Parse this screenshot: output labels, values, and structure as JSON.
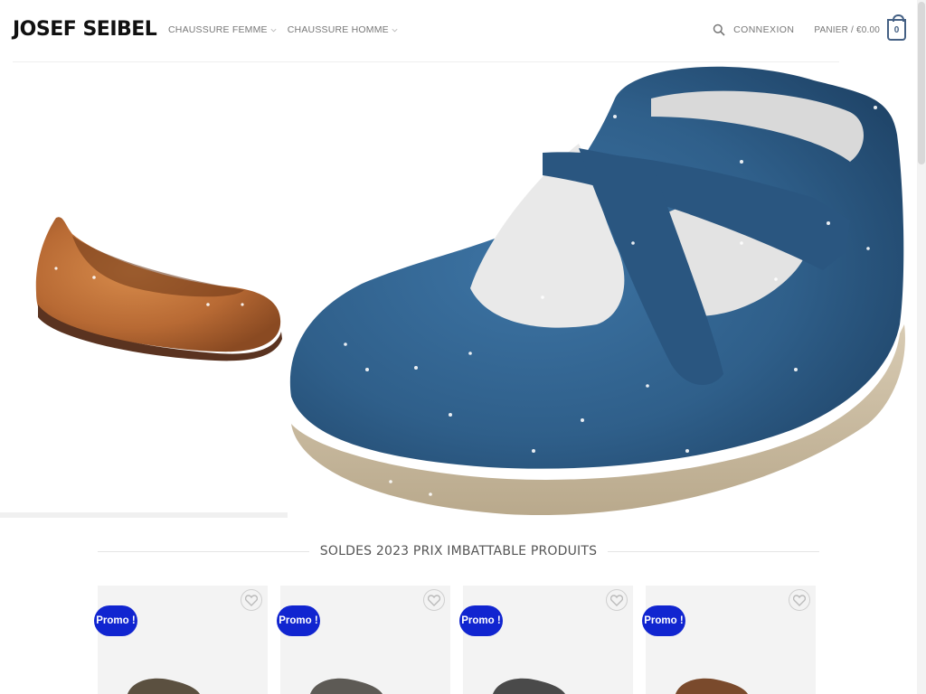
{
  "header": {
    "logo": "JOSEF SEIBEL",
    "nav": [
      {
        "label": "CHAUSSURE FEMME"
      },
      {
        "label": "CHAUSSURE HOMME"
      }
    ],
    "search_icon": "search-icon",
    "login_label": "CONNEXION",
    "cart_label": "PANIER / €0.00",
    "cart_count": "0"
  },
  "colors": {
    "accent": "#446084",
    "promo_badge": "#1125d0",
    "hero_shoe_blue": "#2f5f8a",
    "hero_shoe_tan": "#b86a34"
  },
  "section": {
    "title": "SOLDES 2023 PRIX IMBATTABLE PRODUITS"
  },
  "products": [
    {
      "badge": "Promo !",
      "wishlist_icon": "heart-icon"
    },
    {
      "badge": "Promo !",
      "wishlist_icon": "heart-icon"
    },
    {
      "badge": "Promo !",
      "wishlist_icon": "heart-icon"
    },
    {
      "badge": "Promo !",
      "wishlist_icon": "heart-icon"
    }
  ]
}
